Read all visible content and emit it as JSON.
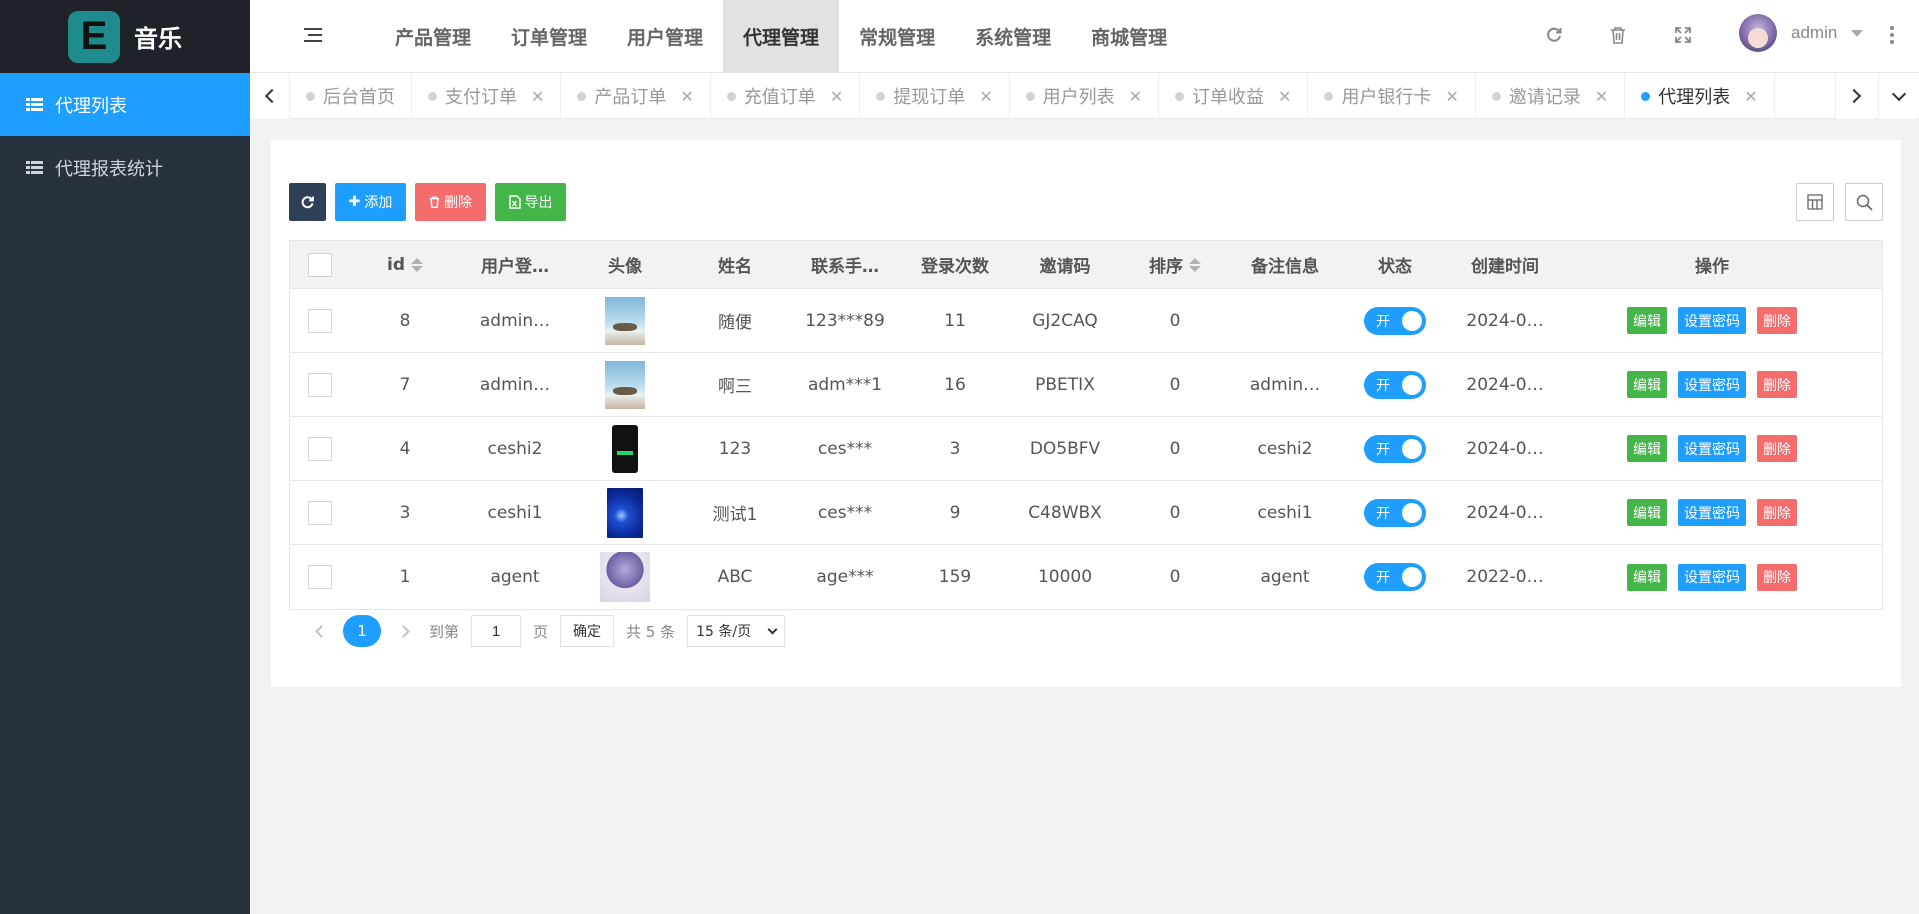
{
  "app": {
    "logo_letter": "E",
    "title": "音乐"
  },
  "sidebar": {
    "items": [
      {
        "label": "代理列表",
        "active": true
      },
      {
        "label": "代理报表统计",
        "active": false
      }
    ]
  },
  "topnav": {
    "items": [
      "产品管理",
      "订单管理",
      "用户管理",
      "代理管理",
      "常规管理",
      "系统管理",
      "商城管理"
    ],
    "active_index": 3
  },
  "header": {
    "user_name": "admin"
  },
  "tabs": [
    {
      "label": "后台首页",
      "closable": false
    },
    {
      "label": "支付订单",
      "closable": true
    },
    {
      "label": "产品订单",
      "closable": true
    },
    {
      "label": "充值订单",
      "closable": true
    },
    {
      "label": "提现订单",
      "closable": true
    },
    {
      "label": "用户列表",
      "closable": true
    },
    {
      "label": "订单收益",
      "closable": true
    },
    {
      "label": "用户银行卡",
      "closable": true
    },
    {
      "label": "邀请记录",
      "closable": true
    },
    {
      "label": "代理列表",
      "closable": true,
      "active": true
    }
  ],
  "toolbar": {
    "add_label": "添加",
    "delete_label": "删除",
    "export_label": "导出"
  },
  "table": {
    "columns": [
      "id",
      "用户登…",
      "头像",
      "姓名",
      "联系手…",
      "登录次数",
      "邀请码",
      "排序",
      "备注信息",
      "状态",
      "创建时间",
      "操作"
    ],
    "rows": [
      {
        "id": "8",
        "username": "admin…",
        "avatar": "sky",
        "name": "随便",
        "phone": "123***89",
        "logins": "11",
        "code": "GJ2CAQ",
        "sort": "0",
        "note": "",
        "status": "开",
        "created": "2024-0…"
      },
      {
        "id": "7",
        "username": "admin…",
        "avatar": "sky",
        "name": "啊三",
        "phone": "adm***1",
        "logins": "16",
        "code": "PBETIX",
        "sort": "0",
        "note": "admin…",
        "status": "开",
        "created": "2024-0…"
      },
      {
        "id": "4",
        "username": "ceshi2",
        "avatar": "phone",
        "name": "123",
        "phone": "ces***",
        "logins": "3",
        "code": "DO5BFV",
        "sort": "0",
        "note": "ceshi2",
        "status": "开",
        "created": "2024-0…"
      },
      {
        "id": "3",
        "username": "ceshi1",
        "avatar": "blue",
        "name": "测试1",
        "phone": "ces***",
        "logins": "9",
        "code": "C48WBX",
        "sort": "0",
        "note": "ceshi1",
        "status": "开",
        "created": "2024-0…"
      },
      {
        "id": "1",
        "username": "agent",
        "avatar": "anime",
        "name": "ABC",
        "phone": "age***",
        "logins": "159",
        "code": "10000",
        "sort": "0",
        "note": "agent",
        "status": "开",
        "created": "2022-0…"
      }
    ],
    "op_labels": {
      "edit": "编辑",
      "password": "设置密码",
      "delete": "删除"
    }
  },
  "pagination": {
    "current": "1",
    "goto_prefix": "到第",
    "goto_value": "1",
    "goto_suffix": "页",
    "confirm": "确定",
    "total": "共 5 条",
    "page_size": "15 条/页"
  },
  "colors": {
    "accent": "#1e9fff",
    "sidebar": "#28323e",
    "success": "#44b549",
    "danger": "#f56c6c",
    "dark_button": "#2f4056"
  }
}
